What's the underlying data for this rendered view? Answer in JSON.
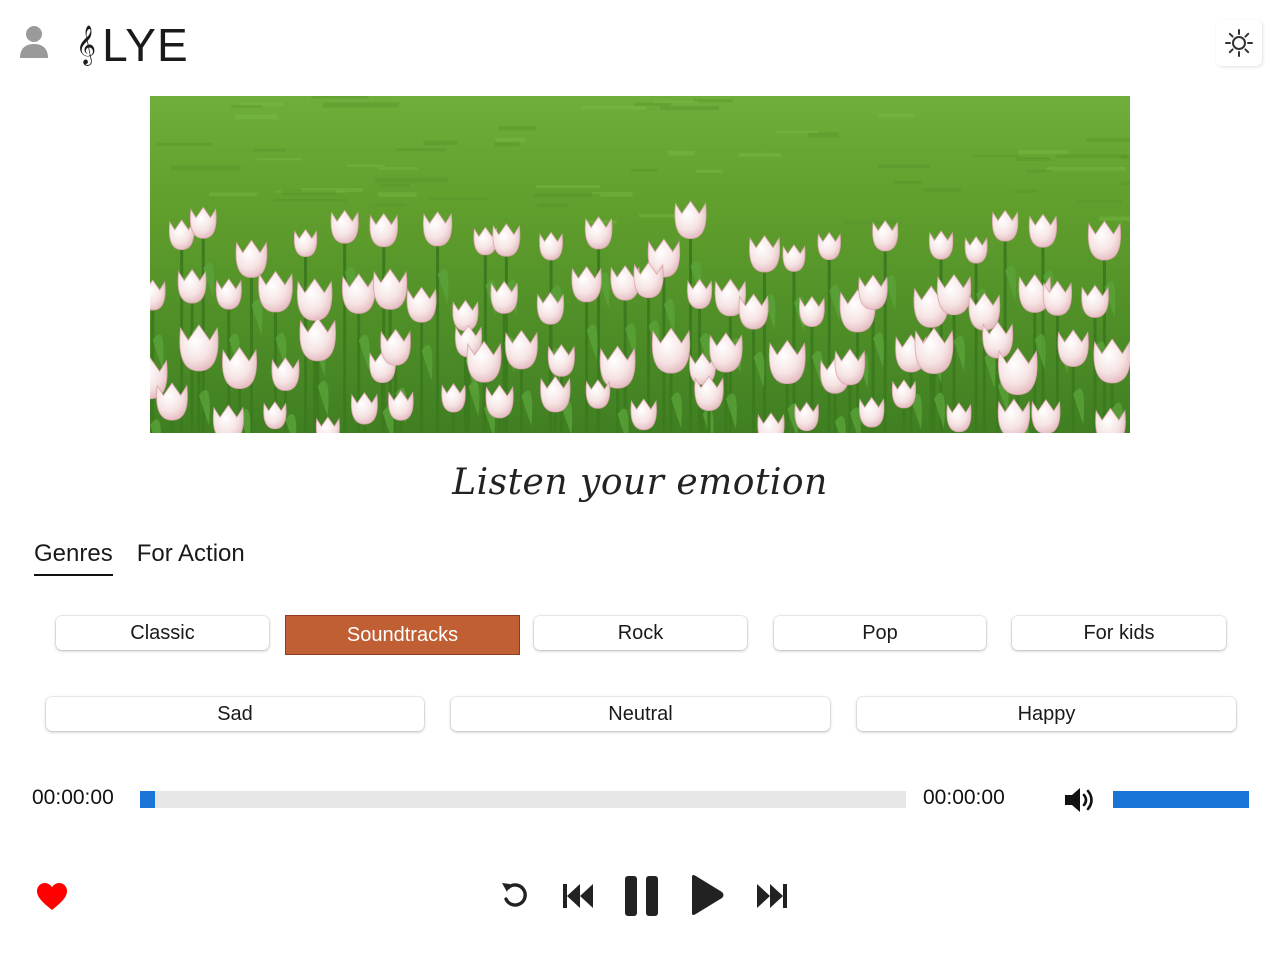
{
  "header": {
    "logo_glyph": "𝄞",
    "app_name": "LYE",
    "avatar_icon": "user-icon",
    "theme_icon": "sun-icon"
  },
  "banner": {
    "description_icon": "tulip-field-image"
  },
  "tagline": "Listen your emotion",
  "tabs": [
    {
      "label": "Genres",
      "active": true
    },
    {
      "label": "For Action",
      "active": false
    }
  ],
  "genres": [
    {
      "label": "Classic",
      "selected": false
    },
    {
      "label": "Soundtracks",
      "selected": true
    },
    {
      "label": "Rock",
      "selected": false
    },
    {
      "label": "Pop",
      "selected": false
    },
    {
      "label": "For kids",
      "selected": false
    }
  ],
  "moods": [
    {
      "label": "Sad"
    },
    {
      "label": "Neutral"
    },
    {
      "label": "Happy"
    }
  ],
  "player": {
    "current_time": "00:00:00",
    "total_time": "00:00:00",
    "progress_fraction": 0.02,
    "volume_fraction": 1.0,
    "volume_icon": "volume-high-icon",
    "controls": [
      "replay-icon",
      "previous-icon",
      "pause-icon",
      "play-icon",
      "next-icon"
    ],
    "favorite_icon": "heart-icon"
  },
  "colors": {
    "accent_selected": "#c05f34",
    "progress": "#1a74d6",
    "favorite": "#ff0000"
  }
}
